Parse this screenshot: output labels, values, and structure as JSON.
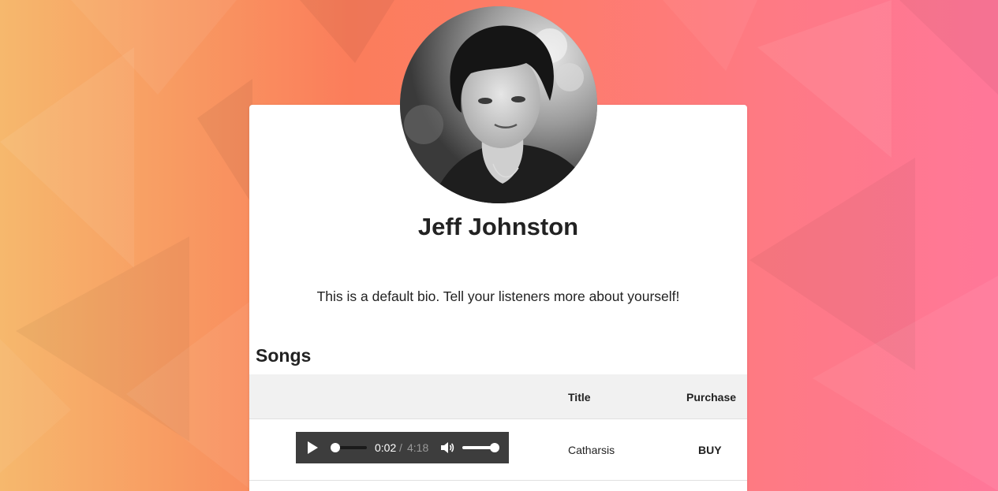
{
  "colors": {
    "background_left": "#f6b86d",
    "background_right": "#ff7799",
    "card": "#ffffff",
    "player": "#3d3d3d",
    "table_header": "#f1f1f1"
  },
  "profile": {
    "artist_name": "Jeff Johnston",
    "bio": "This is a default bio. Tell your listeners more about yourself!"
  },
  "songs": {
    "heading": "Songs",
    "columns": {
      "title": "Title",
      "purchase": "Purchase"
    },
    "rows": [
      {
        "title": "Catharsis",
        "buy_label": "BUY",
        "player": {
          "current_time": "0:02",
          "separator": "/",
          "total_time": "4:18",
          "play_icon": "play-icon",
          "volume_icon": "volume-icon",
          "progress_fraction": 0.008,
          "volume_fraction": 1.0
        }
      }
    ]
  }
}
